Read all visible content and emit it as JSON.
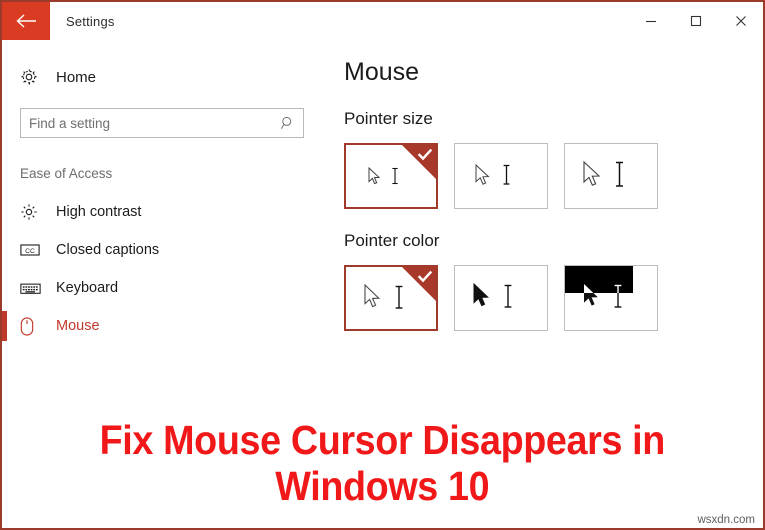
{
  "window": {
    "title": "Settings",
    "back_icon": "back-arrow-icon",
    "minimize_label": "–",
    "maximize_label": "□",
    "close_label": "✕"
  },
  "sidebar": {
    "home": {
      "label": "Home",
      "icon": "gear-icon"
    },
    "search": {
      "placeholder": "Find a setting",
      "value": "",
      "icon": "search-icon"
    },
    "section_header": "Ease of Access",
    "items": [
      {
        "label": "High contrast",
        "icon": "brightness-icon",
        "selected": false
      },
      {
        "label": "Closed captions",
        "icon": "closed-captions-icon",
        "selected": false
      },
      {
        "label": "Keyboard",
        "icon": "keyboard-icon",
        "selected": false
      },
      {
        "label": "Mouse",
        "icon": "mouse-icon",
        "selected": true
      }
    ]
  },
  "main": {
    "page_title": "Mouse",
    "groups": [
      {
        "title": "Pointer size",
        "options": [
          {
            "name": "pointer-size-small",
            "selected": true
          },
          {
            "name": "pointer-size-medium",
            "selected": false
          },
          {
            "name": "pointer-size-large",
            "selected": false
          }
        ]
      },
      {
        "title": "Pointer color",
        "options": [
          {
            "name": "pointer-color-white",
            "selected": true
          },
          {
            "name": "pointer-color-black",
            "selected": false
          },
          {
            "name": "pointer-color-inverted",
            "selected": false
          }
        ]
      }
    ]
  },
  "banner": {
    "line1": "Fix Mouse Cursor Disappears in",
    "line2": "Windows 10",
    "watermark": "wsxdn.com"
  },
  "colors": {
    "back_button_red": "#d93c22",
    "accent_red": "#c0392b",
    "tile_selected_border": "#a03a2b",
    "tile_corner": "#a8392a",
    "banner_red": "#f01818",
    "window_border": "#9a3b2b"
  }
}
